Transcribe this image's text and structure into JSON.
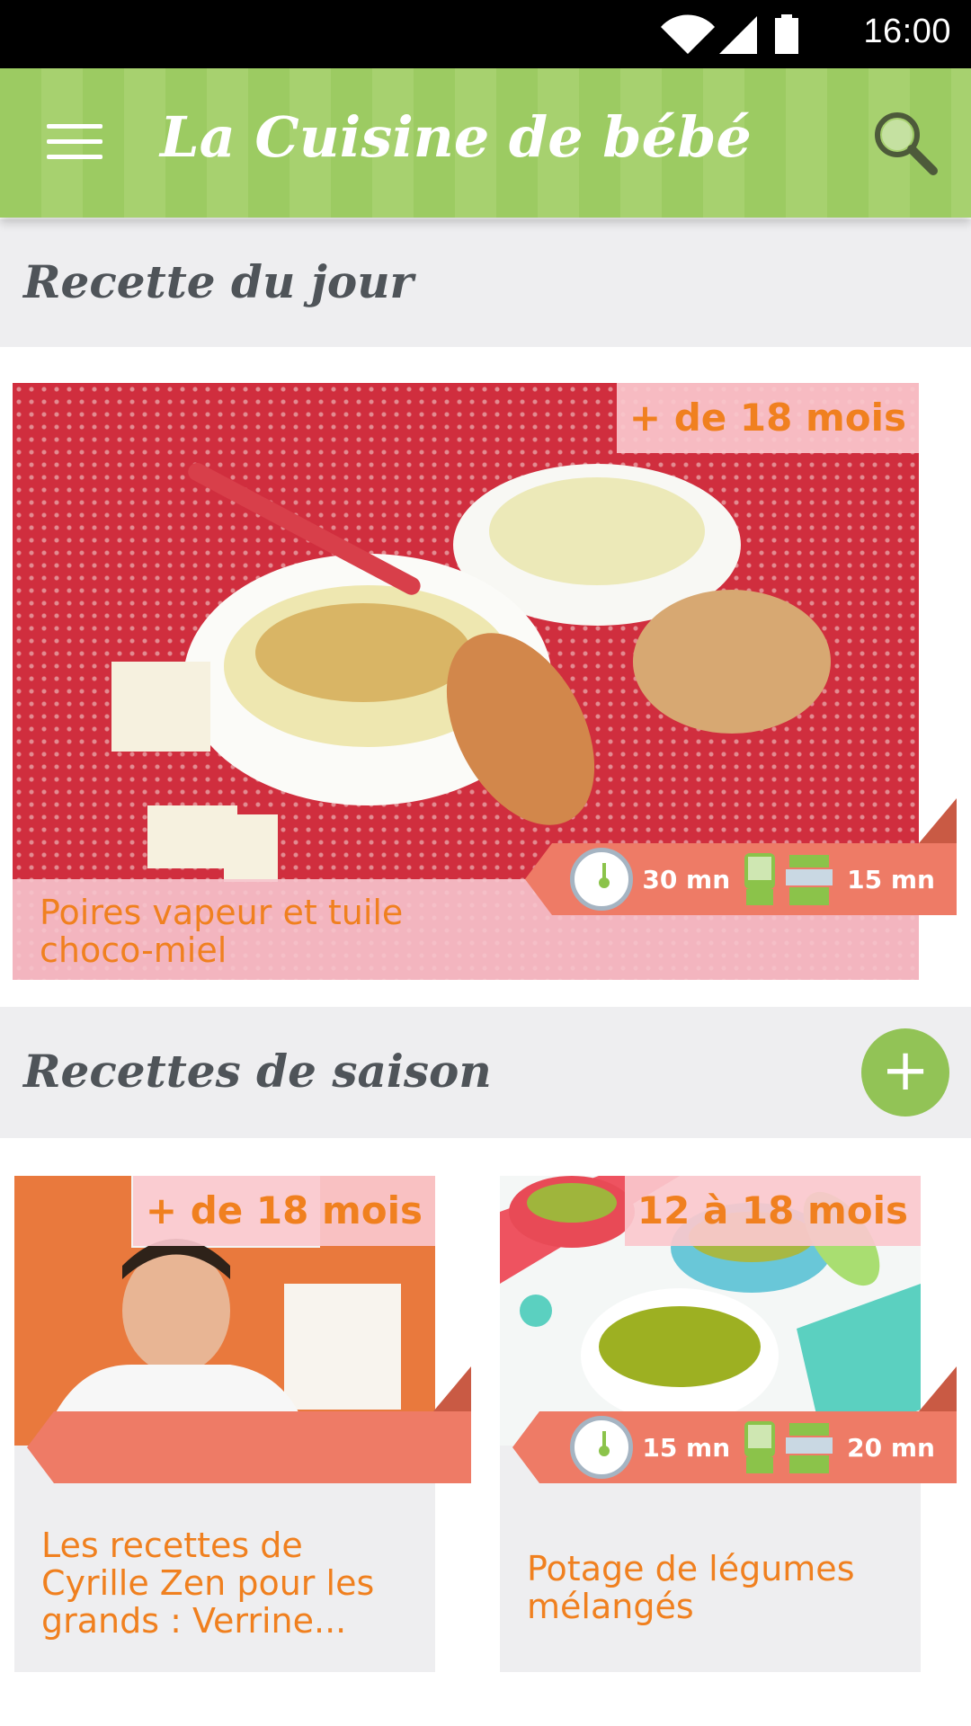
{
  "status_bar": {
    "time": "16:00"
  },
  "app_bar": {
    "title": "La Cuisine de bébé"
  },
  "recipe_of_day": {
    "section_title": "Recette du jour",
    "age": "+ de 18 mois",
    "name": "Poires vapeur et tuile choco-miel",
    "prep_time": "30 mn",
    "cook_time": "15 mn"
  },
  "seasonal": {
    "section_title": "Recettes de saison",
    "add_label": "+",
    "cards": [
      {
        "age": "+ de 18 mois",
        "name": "Les recettes de Cyrille Zen pour les grands : Verrine..."
      },
      {
        "age": "12 à 18 mois",
        "name": "Potage de légumes mélangés",
        "prep_time": "15 mn",
        "cook_time": "20 mn"
      }
    ]
  }
}
